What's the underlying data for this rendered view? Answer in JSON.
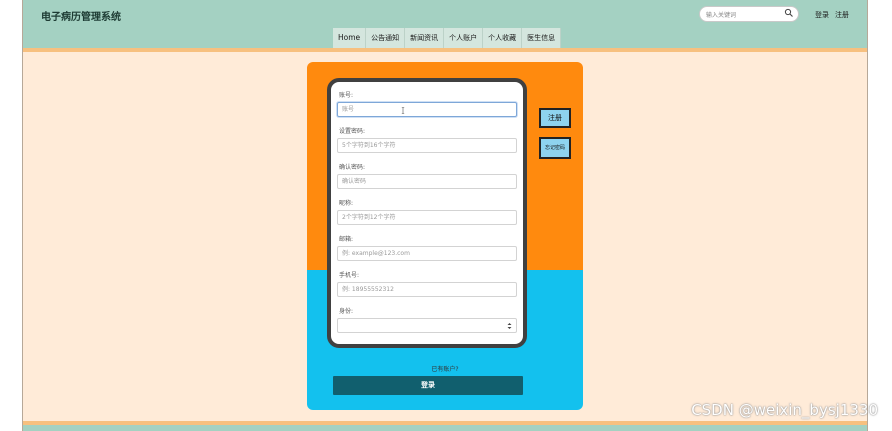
{
  "header": {
    "site_title": "电子病历管理系统",
    "search_placeholder": "输入关键词",
    "login_link": "登录",
    "register_link": "注册"
  },
  "nav": {
    "items": [
      {
        "label": "Home"
      },
      {
        "label": "公告通知"
      },
      {
        "label": "新闻资讯"
      },
      {
        "label": "个人账户"
      },
      {
        "label": "个人收藏"
      },
      {
        "label": "医生信息"
      }
    ]
  },
  "form": {
    "account": {
      "label": "账号:",
      "placeholder": "账号"
    },
    "password": {
      "label": "设置密码:",
      "placeholder": "5个字符到16个字符"
    },
    "confirm": {
      "label": "确认密码:",
      "placeholder": "确认密码"
    },
    "nickname": {
      "label": "昵称:",
      "placeholder": "2个字符到12个字符"
    },
    "email": {
      "label": "邮箱:",
      "placeholder": "例: example@123.com"
    },
    "phone": {
      "label": "手机号:",
      "placeholder": "例: 18955552312"
    },
    "identity": {
      "label": "身份:",
      "selected": ""
    },
    "register_button": "注册",
    "forgot_button": "忘记密码",
    "have_account": "已有账户?",
    "login_button": "登录"
  },
  "watermark": "CSDN @weixin_bysj1330",
  "colors": {
    "topbar": "#a4d1c2",
    "accent_orange": "#ff8a0e",
    "accent_cyan": "#13c1ee",
    "login_button": "#115f6e",
    "page_bg": "#ffebd8"
  },
  "icons": [
    "search-icon",
    "text-cursor-icon",
    "select-arrow-icon"
  ]
}
